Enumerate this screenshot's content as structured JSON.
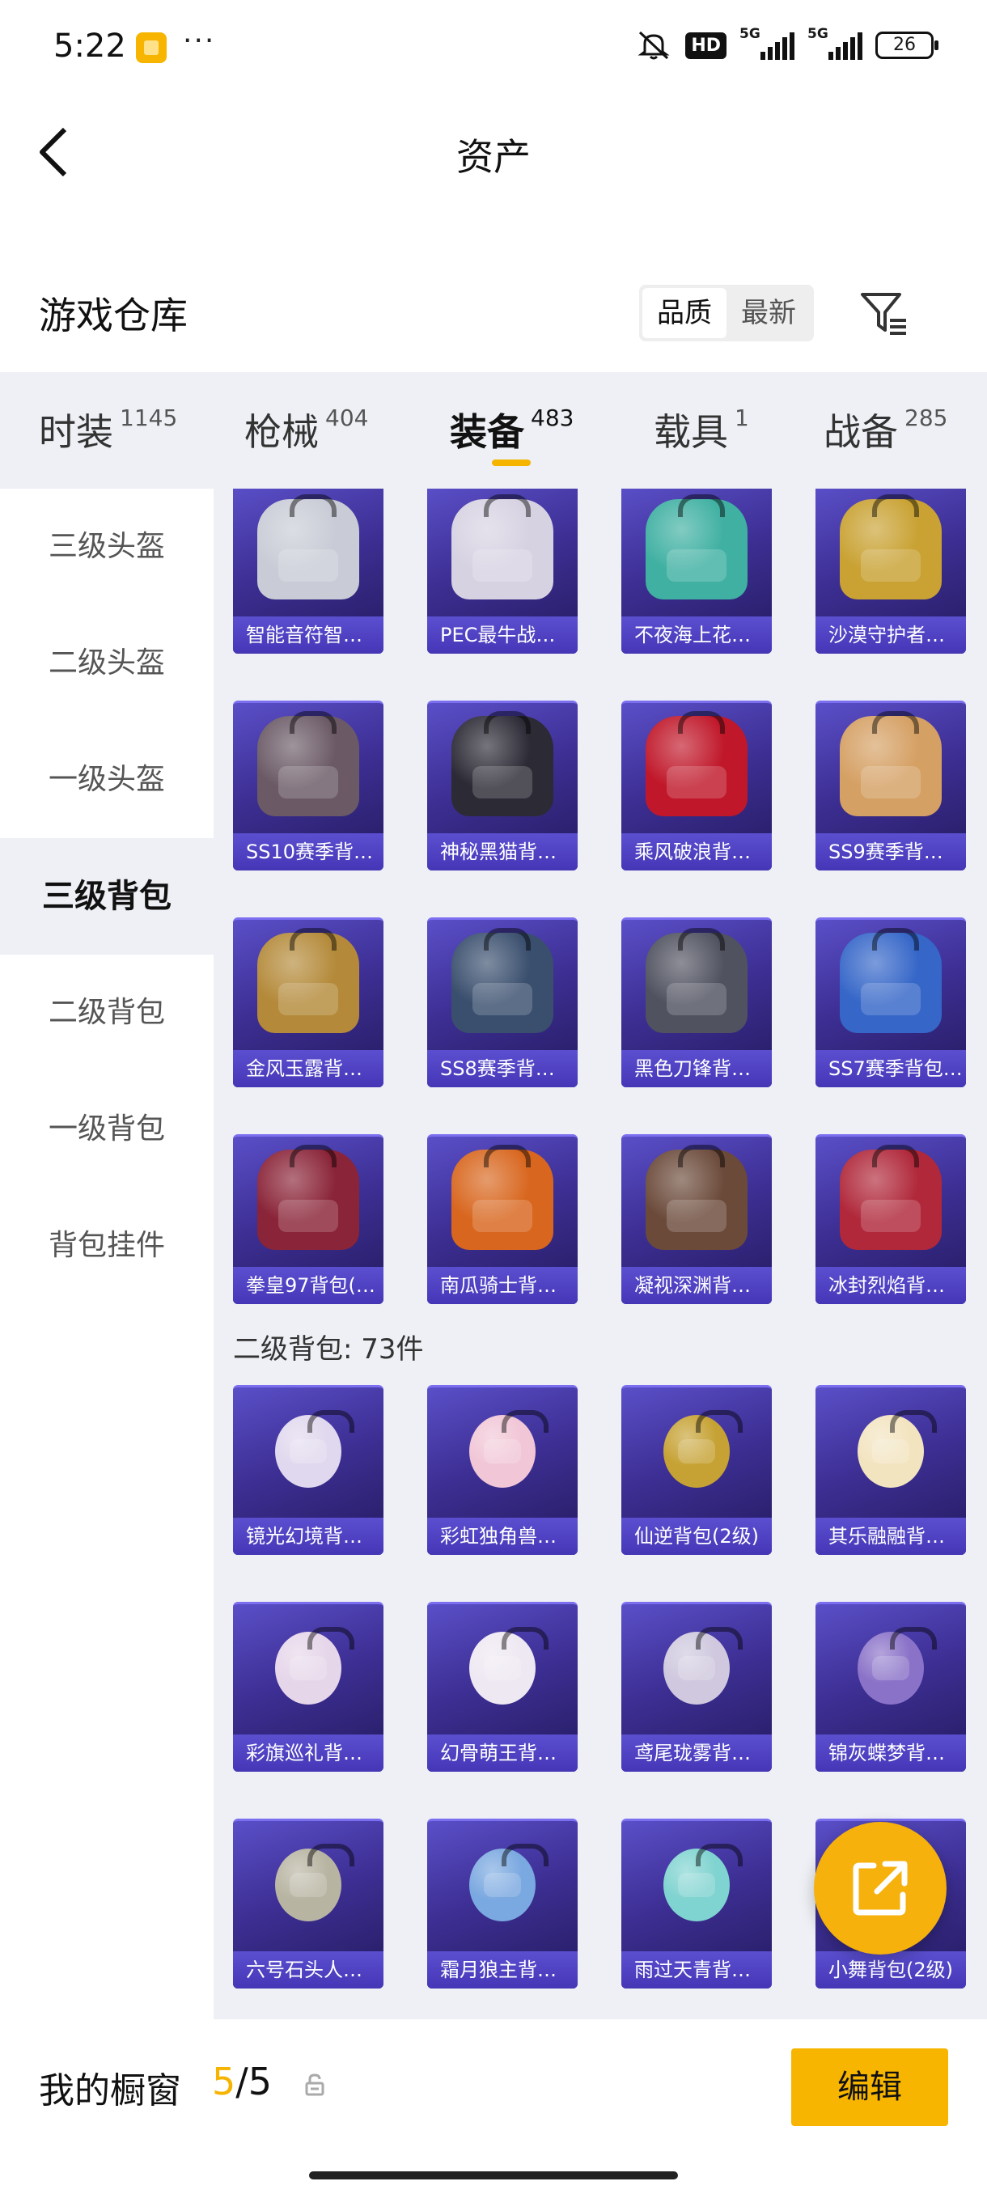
{
  "status_bar": {
    "time": "5:22",
    "more": "···",
    "hd": "HD",
    "net1": "5G",
    "net2": "5G",
    "battery": "26"
  },
  "header": {
    "title": "资产"
  },
  "section": {
    "title": "游戏仓库",
    "sort_options": [
      "品质",
      "最新"
    ],
    "active_sort": "品质"
  },
  "categories": [
    {
      "name": "时装",
      "count": "1145"
    },
    {
      "name": "枪械",
      "count": "404"
    },
    {
      "name": "装备",
      "count": "483",
      "active": true
    },
    {
      "name": "载具",
      "count": "1"
    },
    {
      "name": "战备",
      "count": "285"
    }
  ],
  "sidebar": {
    "items": [
      "三级头盔",
      "二级头盔",
      "一级头盔",
      "三级背包",
      "二级背包",
      "一级背包",
      "背包挂件"
    ],
    "active": "三级背包"
  },
  "group1": {
    "items": [
      {
        "label": "智能音符智…",
        "color": "#c9ccd6"
      },
      {
        "label": "PEC最牛战…",
        "color": "#d7d2e2"
      },
      {
        "label": "不夜海上花…",
        "color": "#3fb0a2"
      },
      {
        "label": "沙漠守护者…",
        "color": "#c9a233"
      },
      {
        "label": "SS10赛季背…",
        "color": "#6b5a66"
      },
      {
        "label": "神秘黑猫背…",
        "color": "#2c2a35"
      },
      {
        "label": "乘风破浪背…",
        "color": "#c0182a"
      },
      {
        "label": "SS9赛季背…",
        "color": "#d5a064"
      },
      {
        "label": "金风玉露背…",
        "color": "#b48a3a"
      },
      {
        "label": "SS8赛季背…",
        "color": "#3a4f6e"
      },
      {
        "label": "黑色刀锋背…",
        "color": "#505260"
      },
      {
        "label": "SS7赛季背包…",
        "color": "#3566c8"
      },
      {
        "label": "拳皇97背包(…",
        "color": "#8a2438"
      },
      {
        "label": "南瓜骑士背…",
        "color": "#d8661e"
      },
      {
        "label": "凝视深渊背…",
        "color": "#6b4a3a"
      },
      {
        "label": "冰封烈焰背…",
        "color": "#b0283a"
      }
    ]
  },
  "group2": {
    "label": "二级背包: 73件",
    "items": [
      {
        "label": "镜光幻境背…",
        "color": "#e0d8ee"
      },
      {
        "label": "彩虹独角兽…",
        "color": "#f1c6d6"
      },
      {
        "label": "仙逆背包(2级)",
        "color": "#c6a234"
      },
      {
        "label": "其乐融融背…",
        "color": "#f3e4c0"
      },
      {
        "label": "彩旗巡礼背…",
        "color": "#e6d6ea"
      },
      {
        "label": "幻骨萌王背…",
        "color": "#eee8f2"
      },
      {
        "label": "鸢尾珑雾背…",
        "color": "#cfc8de"
      },
      {
        "label": "锦灰蝶梦背…",
        "color": "#8a72c8"
      },
      {
        "label": "六号石头人…",
        "color": "#b8b4a2"
      },
      {
        "label": "霜月狼主背…",
        "color": "#7aa8e0"
      },
      {
        "label": "雨过天青背…",
        "color": "#7fd3d0"
      },
      {
        "label": "小舞背包(2级)",
        "color": "#e6b8d2"
      }
    ]
  },
  "bottom": {
    "title": "我的橱窗",
    "current": "5",
    "total": "/5",
    "edit_label": "编辑"
  }
}
